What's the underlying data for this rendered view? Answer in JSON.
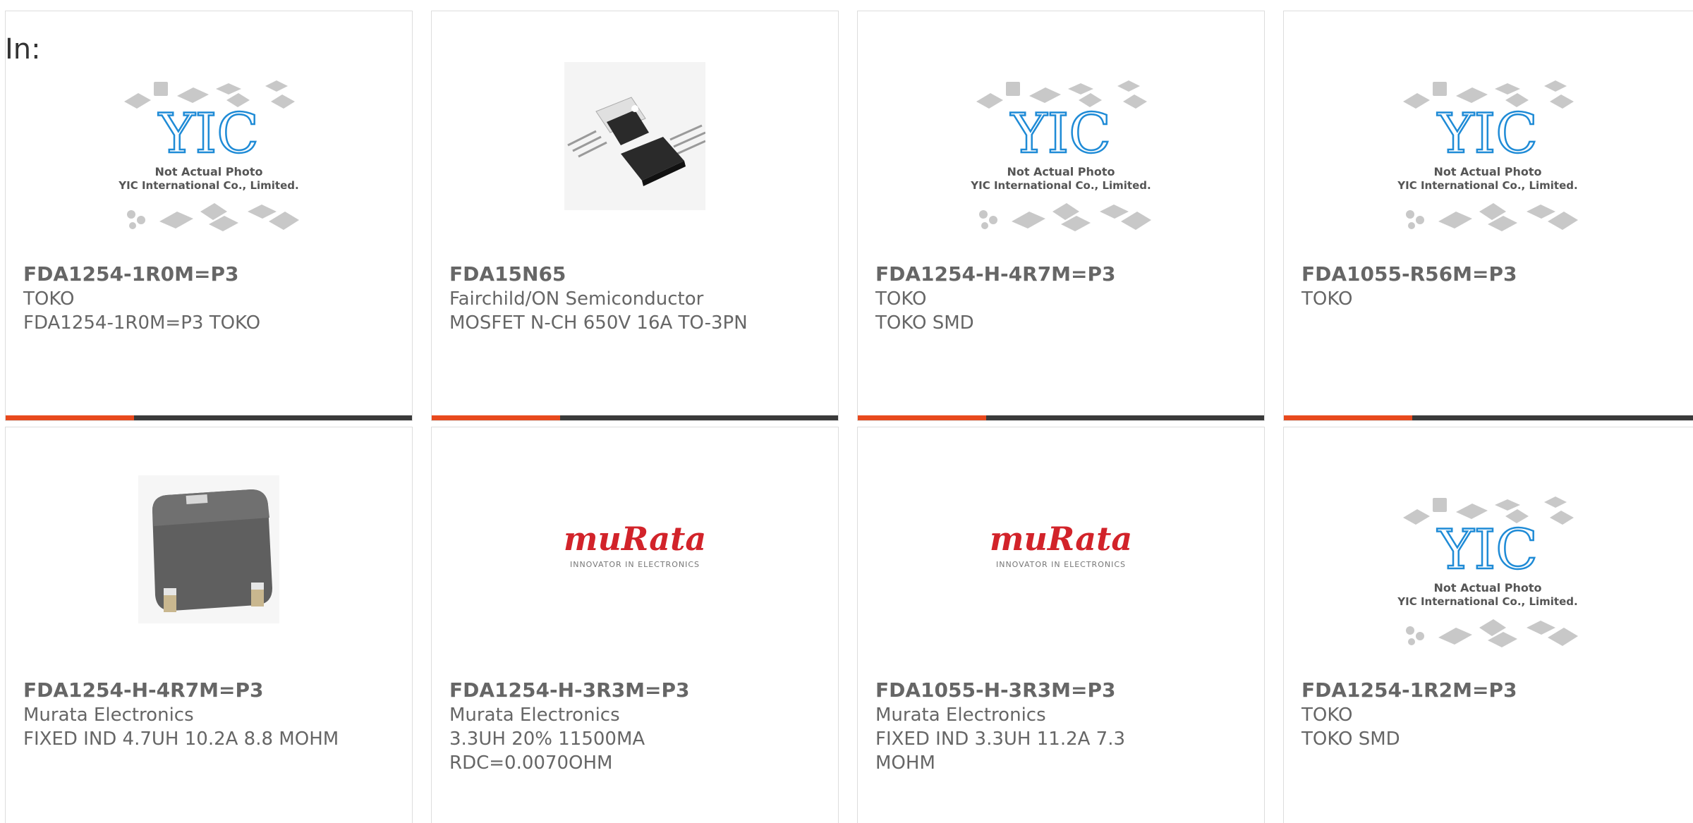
{
  "filter_label": "In:",
  "placeholder_text": {
    "line1": "Not Actual Photo",
    "line2": "YIC International Co., Limited.",
    "logo": "YIC"
  },
  "murata": {
    "logo": "muRata",
    "tagline": "INNOVATOR IN ELECTRONICS",
    "color": "#d2232a"
  },
  "colors": {
    "accent": "#e8491d",
    "bar": "#3a3a3a",
    "text": "#666666",
    "yic_blue": "#1f8bd6"
  },
  "products": [
    {
      "part": "FDA1254-1R0M=P3",
      "mfr": "TOKO",
      "desc": "FDA1254-1R0M=P3 TOKO",
      "image": "yic-placeholder"
    },
    {
      "part": "FDA15N65",
      "mfr": "Fairchild/ON Semiconductor",
      "desc": "MOSFET N-CH 650V 16A TO-3PN",
      "image": "to3p-transistor"
    },
    {
      "part": "FDA1254-H-4R7M=P3",
      "mfr": "TOKO",
      "desc": "TOKO SMD",
      "image": "yic-placeholder"
    },
    {
      "part": "FDA1055-R56M=P3",
      "mfr": "TOKO",
      "desc": "",
      "image": "yic-placeholder"
    },
    {
      "part": "FDA1254-H-4R7M=P3",
      "mfr": "Murata Electronics",
      "desc": "FIXED IND 4.7UH 10.2A 8.8 MOHM",
      "image": "smd-inductor"
    },
    {
      "part": "FDA1254-H-3R3M=P3",
      "mfr": "Murata Electronics",
      "desc": "3.3UH 20% 11500MA RDC=0.0070OHM",
      "image": "murata-logo"
    },
    {
      "part": "FDA1055-H-3R3M=P3",
      "mfr": "Murata Electronics",
      "desc": "FIXED IND 3.3UH 11.2A 7.3 MOHM",
      "image": "murata-logo"
    },
    {
      "part": "FDA1254-1R2M=P3",
      "mfr": "TOKO",
      "desc": "TOKO SMD",
      "image": "yic-placeholder"
    }
  ]
}
